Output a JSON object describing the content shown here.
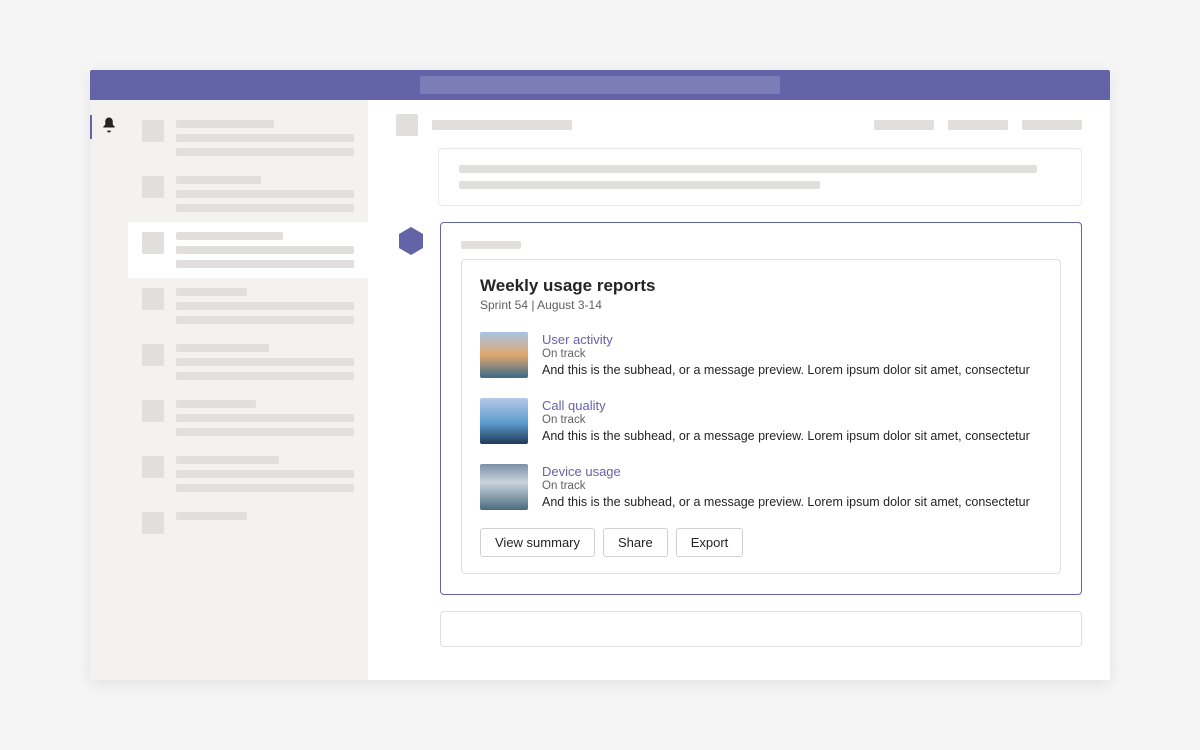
{
  "card": {
    "title": "Weekly usage reports",
    "subtitle": "Sprint 54  |  August 3-14",
    "reports": [
      {
        "link": "User activity",
        "status": "On track",
        "desc": "And this is the subhead, or a message preview. Lorem ipsum dolor sit amet, consectetur"
      },
      {
        "link": "Call quality",
        "status": "On track",
        "desc": "And this is the subhead, or a message preview. Lorem ipsum dolor sit amet, consectetur"
      },
      {
        "link": "Device usage",
        "status": "On track",
        "desc": "And this is the subhead, or a message preview. Lorem ipsum dolor sit amet, consectetur"
      }
    ],
    "actions": {
      "view_summary": "View summary",
      "share": "Share",
      "export": "Export"
    }
  },
  "colors": {
    "brand": "#6264A7"
  }
}
